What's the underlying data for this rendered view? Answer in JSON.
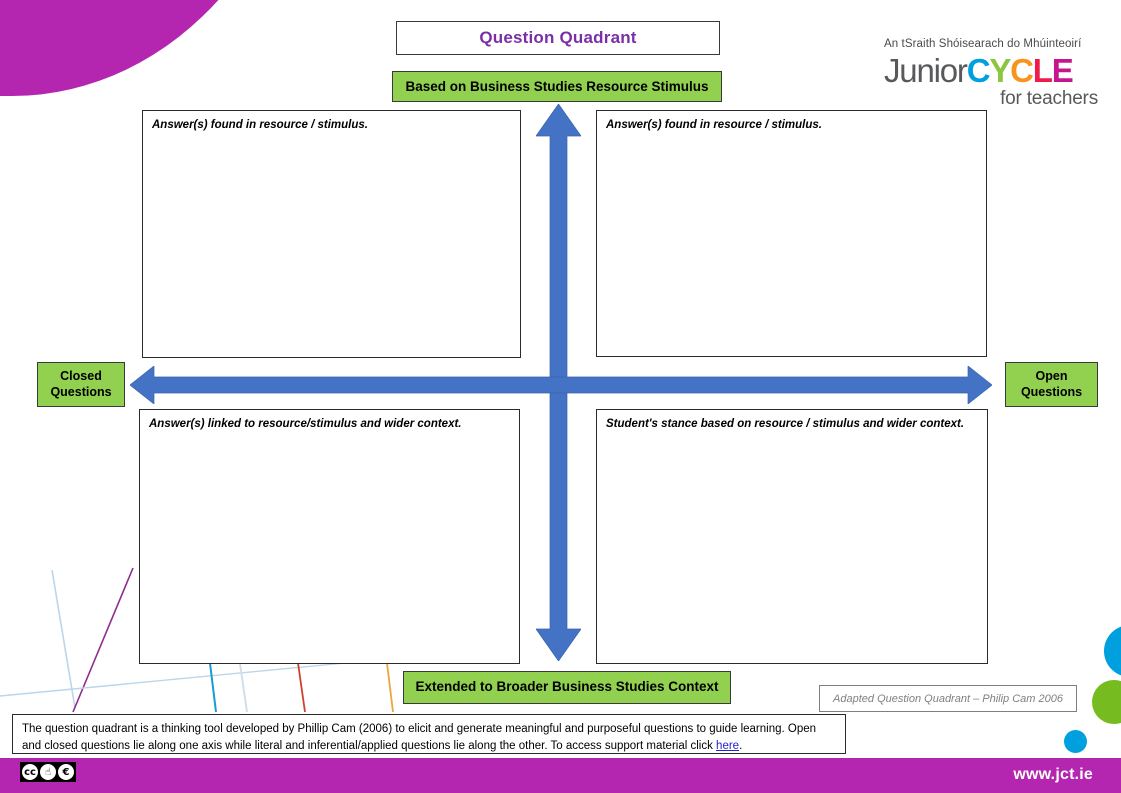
{
  "header": {
    "title": "Question Quadrant",
    "subtitle": "Based on Business Studies Resource Stimulus",
    "title_color": "#7A2FA8",
    "subtitle_bg": "#92D050"
  },
  "logo": {
    "irish_line": "An tSraith Shóisearach do Mhúinteoirí",
    "word_junior": "Junior",
    "letter_c1": "C",
    "letter_y": "Y",
    "letter_c2": "C",
    "letter_l": "L",
    "letter_e": "E",
    "tagline": "for teachers",
    "colors": {
      "junior": "#58595B",
      "c1": "#00A0DF",
      "y": "#8CC63E",
      "c2": "#F7941E",
      "l": "#ED1C4A",
      "e": "#C6168D"
    }
  },
  "quadrants": {
    "top_left": "Answer(s) found in resource / stimulus.",
    "top_right": "Answer(s) found in resource / stimulus.",
    "bottom_left": "Answer(s) linked to resource/stimulus and wider context.",
    "bottom_right": "Student's stance based on resource / stimulus and wider context."
  },
  "axes": {
    "left_label": "Closed\nQuestions",
    "left_label_line1": "Closed",
    "left_label_line2": "Questions",
    "right_label_line1": "Open",
    "right_label_line2": "Questions",
    "bottom_label": "Extended to Broader Business Studies Context",
    "arrow_color": "#4472C4"
  },
  "attribution": {
    "text": "Adapted Question Quadrant – Philip Cam 2006"
  },
  "footer_note": {
    "part1": "The question quadrant is a thinking tool developed by Phillip Cam (2006) to elicit and generate meaningful and purposeful questions to guide learning. Open and closed questions lie along one axis while literal and inferential/applied questions lie along the other.   To access support material click ",
    "link_text": "here",
    "part2": "."
  },
  "bottom_bar": {
    "url": "www.jct.ie",
    "bar_color": "#B425B0",
    "license_by": "BY",
    "license_nc": "NC"
  },
  "decor": {
    "circle_blue_large": "#00A0DF",
    "circle_green": "#76BC21",
    "circle_blue_small": "#00A0DF",
    "corner_magenta": "#B425B0"
  }
}
